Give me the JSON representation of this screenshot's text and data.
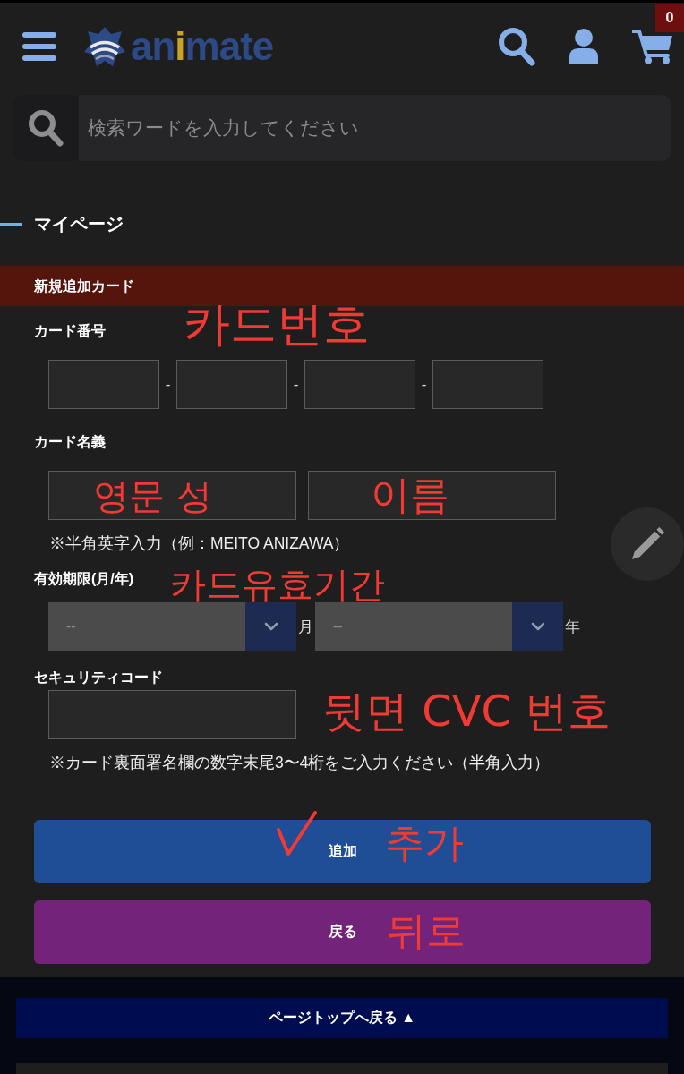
{
  "header": {
    "logo": [
      {
        "text": "an",
        "accent": false
      },
      {
        "text": "i",
        "accent": true
      },
      {
        "text": "mate",
        "accent": false
      }
    ],
    "cart_count": "0"
  },
  "search": {
    "placeholder": "検索ワードを入力してください"
  },
  "page_title": "マイページ",
  "form": {
    "title": "新規追加カード",
    "fields": [
      {
        "label": "カード番号",
        "inputs": [
          {
            "kind": "short",
            "suffix": "-"
          },
          {
            "kind": "short",
            "suffix": "-"
          },
          {
            "kind": "short",
            "suffix": "-"
          },
          {
            "kind": "short"
          }
        ]
      },
      {
        "label": "カード名義",
        "inputs": [
          {
            "kind": "long"
          },
          {
            "kind": "long"
          }
        ],
        "note": "※半角英字入力（例：MEITO ANIZAWA）"
      },
      {
        "label": "有効期限(月/年)",
        "inputs": [
          {
            "kind": "select",
            "value": "--",
            "suffix": "月"
          },
          {
            "kind": "select",
            "value": "--",
            "suffix": "年"
          }
        ]
      },
      {
        "label": "セキュリティコード",
        "inputs": [
          {
            "kind": "long"
          }
        ],
        "note": "※カード裏面署名欄の数字末尾3〜4桁をご入力ください（半角入力）"
      }
    ]
  },
  "buttons": [
    {
      "label": "追加",
      "kind": "primary"
    },
    {
      "label": "戻る",
      "kind": "secondary"
    }
  ],
  "page_top": {
    "label": "ページトップへ戻る ▲"
  },
  "annotations": [
    {
      "kind": "text",
      "text": "카드번호"
    },
    {
      "kind": "text",
      "text": "영문 성"
    },
    {
      "kind": "text",
      "text": "이름"
    },
    {
      "kind": "text",
      "text": "카드유효기간"
    },
    {
      "kind": "text",
      "text": "뒷면 CVC 번호"
    },
    {
      "kind": "check"
    },
    {
      "kind": "text",
      "text": "추가"
    },
    {
      "kind": "text",
      "text": "뒤로"
    }
  ]
}
